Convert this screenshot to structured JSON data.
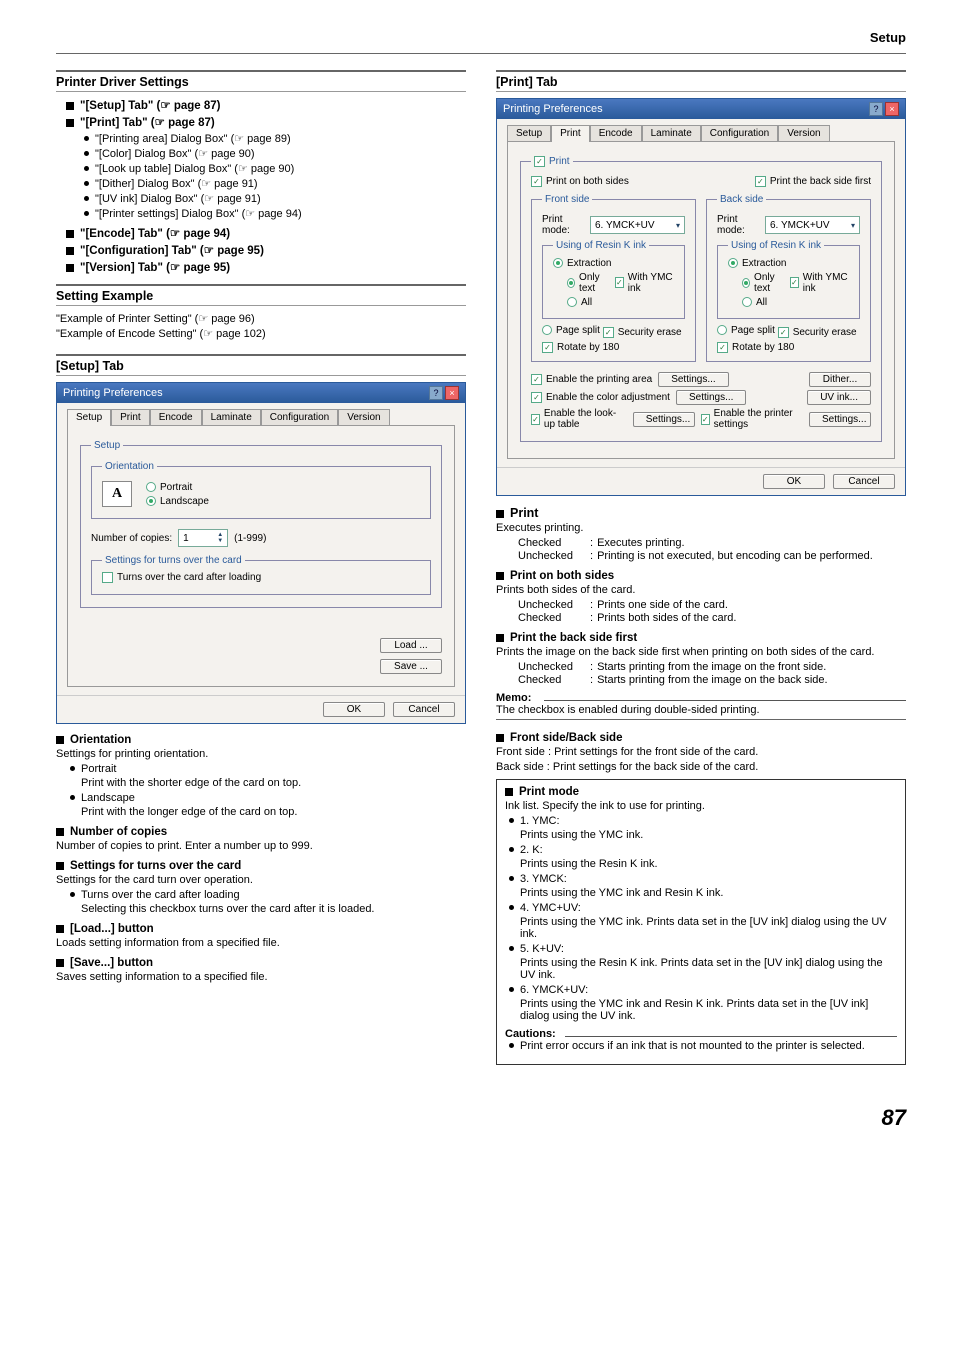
{
  "header": {
    "right": "Setup"
  },
  "page_number": "87",
  "left": {
    "sect1_title": "Printer Driver Settings",
    "items": [
      {
        "label": "\"[Setup] Tab\" (",
        "ref": "☞ page 87)"
      },
      {
        "label": "\"[Print] Tab\" (",
        "ref": "☞ page 87)"
      }
    ],
    "sub_bullets": [
      {
        "text": "\"[Printing area] Dialog Box\" (",
        "ref": "☞ page 89)"
      },
      {
        "text": "\"[Color] Dialog Box\" (",
        "ref": "☞ page 90)"
      },
      {
        "text": "\"[Look up table] Dialog Box\" (",
        "ref": "☞ page 90)"
      },
      {
        "text": "\"[Dither] Dialog Box\" (",
        "ref": "☞ page 91)"
      },
      {
        "text": "\"[UV ink] Dialog Box\" (",
        "ref": "☞ page 91)"
      },
      {
        "text": "\"[Printer settings] Dialog Box\" (",
        "ref": "☞ page 94)"
      }
    ],
    "items2": [
      {
        "label": "\"[Encode] Tab\" (",
        "ref": "☞ page 94)"
      },
      {
        "label": "\"[Configuration] Tab\" (",
        "ref": "☞ page 95)"
      },
      {
        "label": "\"[Version] Tab\" (",
        "ref": "☞ page 95)"
      }
    ],
    "sect2_title": "Setting Example",
    "examples": [
      {
        "text": "\"Example of Printer Setting\" (",
        "ref": "☞ page 96)"
      },
      {
        "text": "\"Example of Encode Setting\" (",
        "ref": "☞ page 102)"
      }
    ],
    "setup_tab_title": "[Setup] Tab",
    "dialog_setup": {
      "title": "Printing Preferences",
      "tabs": [
        "Setup",
        "Print",
        "Encode",
        "Laminate",
        "Configuration",
        "Version"
      ],
      "group_setup": "Setup",
      "group_orientation": "Orientation",
      "portrait": "Portrait",
      "landscape": "Landscape",
      "orientation_icon": "A",
      "num_copies_label": "Number of copies:",
      "num_copies_value": "1",
      "num_copies_range": "(1-999)",
      "group_turns": "Settings for turns over the card",
      "turns_check": "Turns over the card after loading",
      "load_btn": "Load ...",
      "save_btn": "Save ...",
      "ok": "OK",
      "cancel": "Cancel"
    },
    "h_orientation": "Orientation",
    "h_orientation_desc": "Settings for printing orientation.",
    "portrait_label": "Portrait",
    "portrait_desc": "Print with the shorter edge of the card on top.",
    "landscape_label": "Landscape",
    "landscape_desc": "Print with the longer edge of the card on top.",
    "h_copies": "Number of copies",
    "h_copies_desc": "Number of copies to print. Enter a number up to 999.",
    "h_turns": "Settings for turns over the card",
    "h_turns_desc": "Settings for the card turn over operation.",
    "turns_bullet": "Turns over the card after loading",
    "turns_bullet_desc": "Selecting this checkbox turns over the card after it is loaded.",
    "h_load": "[Load...] button",
    "h_load_desc": "Loads setting information from a specified file.",
    "h_save": "[Save...] button",
    "h_save_desc": "Saves setting information to a specified file."
  },
  "right": {
    "print_tab_title": "[Print] Tab",
    "dialog_print": {
      "title": "Printing Preferences",
      "tabs": [
        "Setup",
        "Print",
        "Encode",
        "Laminate",
        "Configuration",
        "Version"
      ],
      "print_check": "Print",
      "both_sides": "Print on both sides",
      "back_first": "Print the back side first",
      "front_side": "Front side",
      "back_side": "Back side",
      "print_mode": "Print mode:",
      "mode_value": "6. YMCK+UV",
      "resink": "Using of Resin K ink",
      "extraction": "Extraction",
      "only_text": "Only text",
      "with_ymc": "With YMC ink",
      "all": "All",
      "page_split": "Page split",
      "security_erase": "Security erase",
      "rotate": "Rotate by 180",
      "enable_area": "Enable the printing area",
      "enable_color": "Enable the color adjustment",
      "enable_lookup": "Enable the look-up table",
      "enable_printer": "Enable the printer settings",
      "settings_btn": "Settings...",
      "dither_btn": "Dither...",
      "uv_btn": "UV ink...",
      "ok": "OK",
      "cancel": "Cancel"
    },
    "h_print": "Print",
    "h_print_desc": "Executes printing.",
    "print_rows": [
      {
        "k": "Checked",
        "v": "Executes printing."
      },
      {
        "k": "Unchecked",
        "v": "Printing is not executed, but encoding can be performed."
      }
    ],
    "h_both": "Print on both sides",
    "h_both_desc": "Prints both sides of the card.",
    "both_rows": [
      {
        "k": "Unchecked",
        "v": "Prints one side of the card."
      },
      {
        "k": "Checked",
        "v": "Prints both sides of the card."
      }
    ],
    "h_back": "Print the back side first",
    "h_back_desc": "Prints the image on the back side first when printing on both sides of the card.",
    "back_rows": [
      {
        "k": "Unchecked",
        "v": "Starts printing from the image on the front side."
      },
      {
        "k": "Checked",
        "v": "Starts printing from the image on the back side."
      }
    ],
    "memo_label": "Memo:",
    "memo_text": "The checkbox is enabled during double-sided printing.",
    "h_fb": "Front side/Back side",
    "fb_front": "Front side : Print settings for the front side of the card.",
    "fb_back": "Back side : Print settings for the back side of the card.",
    "box_pm": "Print mode",
    "box_pm_desc": "Ink list. Specify the ink to use for printing.",
    "pm_items": [
      {
        "t": "1. YMC:",
        "d": "Prints using the YMC ink."
      },
      {
        "t": "2. K:",
        "d": "Prints using the Resin K ink."
      },
      {
        "t": "3. YMCK:",
        "d": "Prints using the YMC ink and Resin K ink."
      },
      {
        "t": "4. YMC+UV:",
        "d": "Prints using the YMC ink. Prints data set in the [UV ink] dialog using the UV ink."
      },
      {
        "t": "5. K+UV:",
        "d": "Prints using the Resin K ink. Prints data set in the [UV ink] dialog using the UV ink."
      },
      {
        "t": "6. YMCK+UV:",
        "d": "Prints using the YMC ink and Resin K ink. Prints data set in the [UV ink] dialog using the UV ink."
      }
    ],
    "cautions_label": "Cautions:",
    "cautions_text": "Print error occurs if an ink that is not mounted to the printer is selected."
  }
}
